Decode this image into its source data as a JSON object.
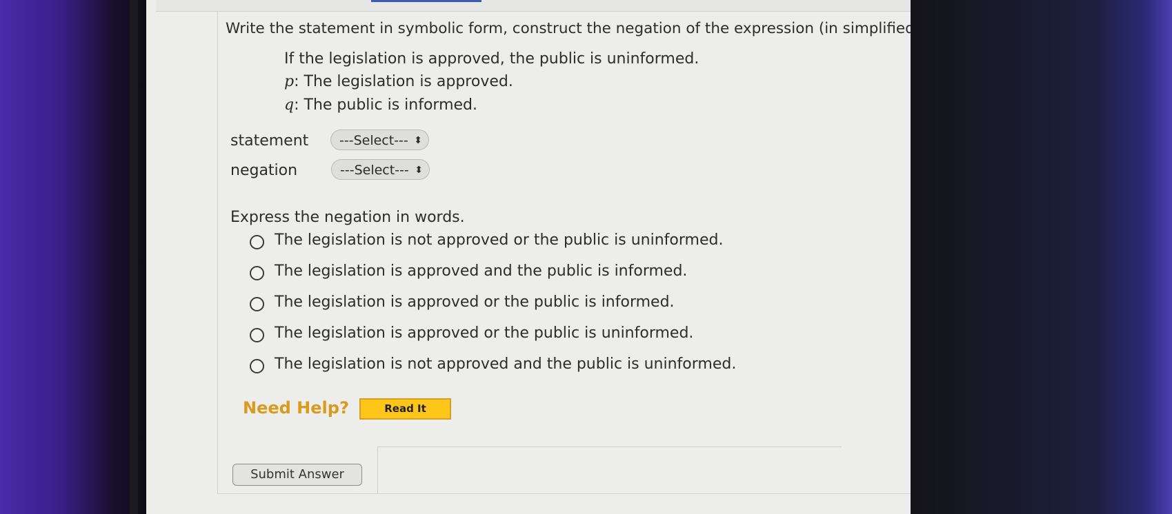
{
  "question": {
    "prompt": "Write the statement in symbolic form, construct the negation of the expression (in simplified",
    "sentence": "If the legislation is approved, the public is uninformed.",
    "p_var": "p",
    "p_def": ": The legislation is approved.",
    "q_var": "q",
    "q_def": ": The public is informed."
  },
  "fields": {
    "statement_label": "statement",
    "statement_select": "---Select---",
    "negation_label": "negation",
    "negation_select": "---Select---"
  },
  "words": {
    "prompt": "Express the negation in words.",
    "options": [
      "The legislation is not approved or the public is uninformed.",
      "The legislation is approved and the public is informed.",
      "The legislation is approved or the public is informed.",
      "The legislation is approved or the public is uninformed.",
      "The legislation is not approved and the public is uninformed."
    ]
  },
  "help": {
    "label": "Need Help?",
    "read_it": "Read It"
  },
  "submit_label": "Submit Answer",
  "colors": {
    "help_text": "#d99a1d",
    "read_it_bg": "#ffc61a"
  }
}
